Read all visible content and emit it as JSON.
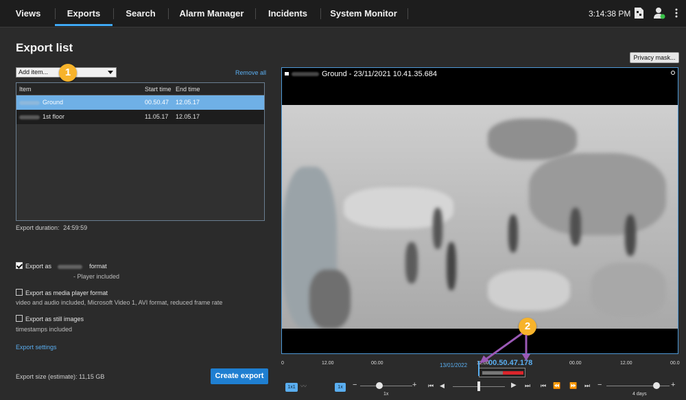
{
  "nav": {
    "tabs": [
      {
        "label": "Views"
      },
      {
        "label": "Exports"
      },
      {
        "label": "Search"
      },
      {
        "label": "Alarm Manager"
      },
      {
        "label": "Incidents"
      },
      {
        "label": "System Monitor"
      }
    ],
    "active_tab": "Exports",
    "clock": "3:14:38 PM"
  },
  "export_list": {
    "title": "Export list",
    "add_item": "Add item...",
    "remove_all": "Remove all",
    "columns": {
      "item": "Item",
      "start": "Start time",
      "end": "End time"
    },
    "rows": [
      {
        "name": "Ground",
        "start": "00.50.47",
        "end": "12.05.17",
        "selected": true
      },
      {
        "name": "1st floor",
        "start": "11.05.17",
        "end": "12.05.17",
        "selected": false
      }
    ],
    "duration_label": "Export duration:",
    "duration_value": "24:59:59"
  },
  "options": {
    "format": {
      "prefix": "Export as",
      "suffix": "format",
      "note": "- Player included",
      "checked": true
    },
    "media": {
      "label": "Export as media player format",
      "note": "video and audio included, Microsoft Video 1, AVI format, reduced frame rate",
      "checked": false
    },
    "still": {
      "label": "Export as still images",
      "note": "timestamps included",
      "checked": false
    }
  },
  "settings_link": "Export settings",
  "size_label": "Export size (estimate): 11,15 GB",
  "create_button": "Create export",
  "badges": {
    "one": "1",
    "two": "2"
  },
  "video": {
    "privacy_mask": "Privacy mask...",
    "camera_title": "Ground - 23/11/2021 10.41.35.684"
  },
  "timeline": {
    "ticks": [
      "0",
      "12.00",
      "00.00",
      "12.00",
      "00.00",
      "12.00",
      "00.0"
    ],
    "date": "13/01/2022",
    "time": "00.50.47.178",
    "speed_label": "1x",
    "speed_button": "1x",
    "span_label": "4 days",
    "left_button": "1x1"
  },
  "colors": {
    "accent": "#3fa9f5",
    "selection": "#6fb0e6",
    "badge": "#f7b32b",
    "button": "#1f7fd1",
    "marker": "#d9252b",
    "arrow": "#9b59b6"
  }
}
